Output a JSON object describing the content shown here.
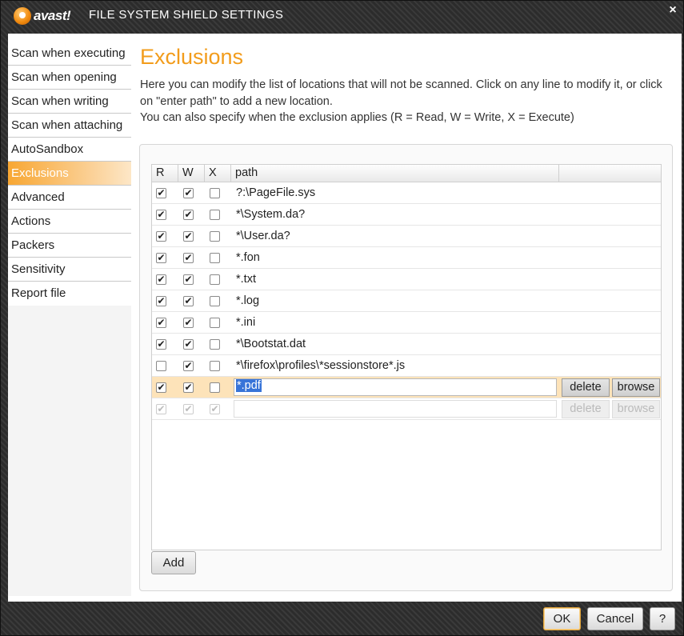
{
  "window": {
    "logo_text": "avast!",
    "title": "FILE SYSTEM SHIELD SETTINGS",
    "close_label": "×"
  },
  "sidebar": {
    "items": [
      {
        "label": "Scan when executing"
      },
      {
        "label": "Scan when opening"
      },
      {
        "label": "Scan when writing"
      },
      {
        "label": "Scan when attaching"
      },
      {
        "label": "AutoSandbox"
      },
      {
        "label": "Exclusions",
        "active": true
      },
      {
        "label": "Advanced"
      },
      {
        "label": "Actions"
      },
      {
        "label": "Packers"
      },
      {
        "label": "Sensitivity"
      },
      {
        "label": "Report file"
      }
    ]
  },
  "main": {
    "title": "Exclusions",
    "description_line1": "Here you can modify the list of locations that will not be scanned. Click on any line to modify it, or click on \"enter path\" to add a new location.",
    "description_line2": "You can also specify when the exclusion applies (R = Read, W = Write, X = Execute)"
  },
  "table": {
    "headers": {
      "r": "R",
      "w": "W",
      "x": "X",
      "path": "path"
    },
    "rows": [
      {
        "r": true,
        "w": true,
        "x": false,
        "path": "?:\\PageFile.sys"
      },
      {
        "r": true,
        "w": true,
        "x": false,
        "path": "*\\System.da?"
      },
      {
        "r": true,
        "w": true,
        "x": false,
        "path": "*\\User.da?"
      },
      {
        "r": true,
        "w": true,
        "x": false,
        "path": "*.fon"
      },
      {
        "r": true,
        "w": true,
        "x": false,
        "path": "*.txt"
      },
      {
        "r": true,
        "w": true,
        "x": false,
        "path": "*.log"
      },
      {
        "r": true,
        "w": true,
        "x": false,
        "path": "*.ini"
      },
      {
        "r": true,
        "w": true,
        "x": false,
        "path": "*\\Bootstat.dat"
      },
      {
        "r": false,
        "w": true,
        "x": false,
        "path": "*\\firefox\\profiles\\*sessionstore*.js"
      }
    ],
    "editing_row": {
      "r": true,
      "w": true,
      "x": false,
      "path": "*.pdf",
      "delete_label": "delete",
      "browse_label": "browse"
    },
    "new_row": {
      "r": true,
      "w": true,
      "x": true,
      "path": "",
      "delete_label": "delete",
      "browse_label": "browse"
    }
  },
  "add_label": "Add",
  "footer": {
    "ok": "OK",
    "cancel": "Cancel",
    "help": "?"
  }
}
